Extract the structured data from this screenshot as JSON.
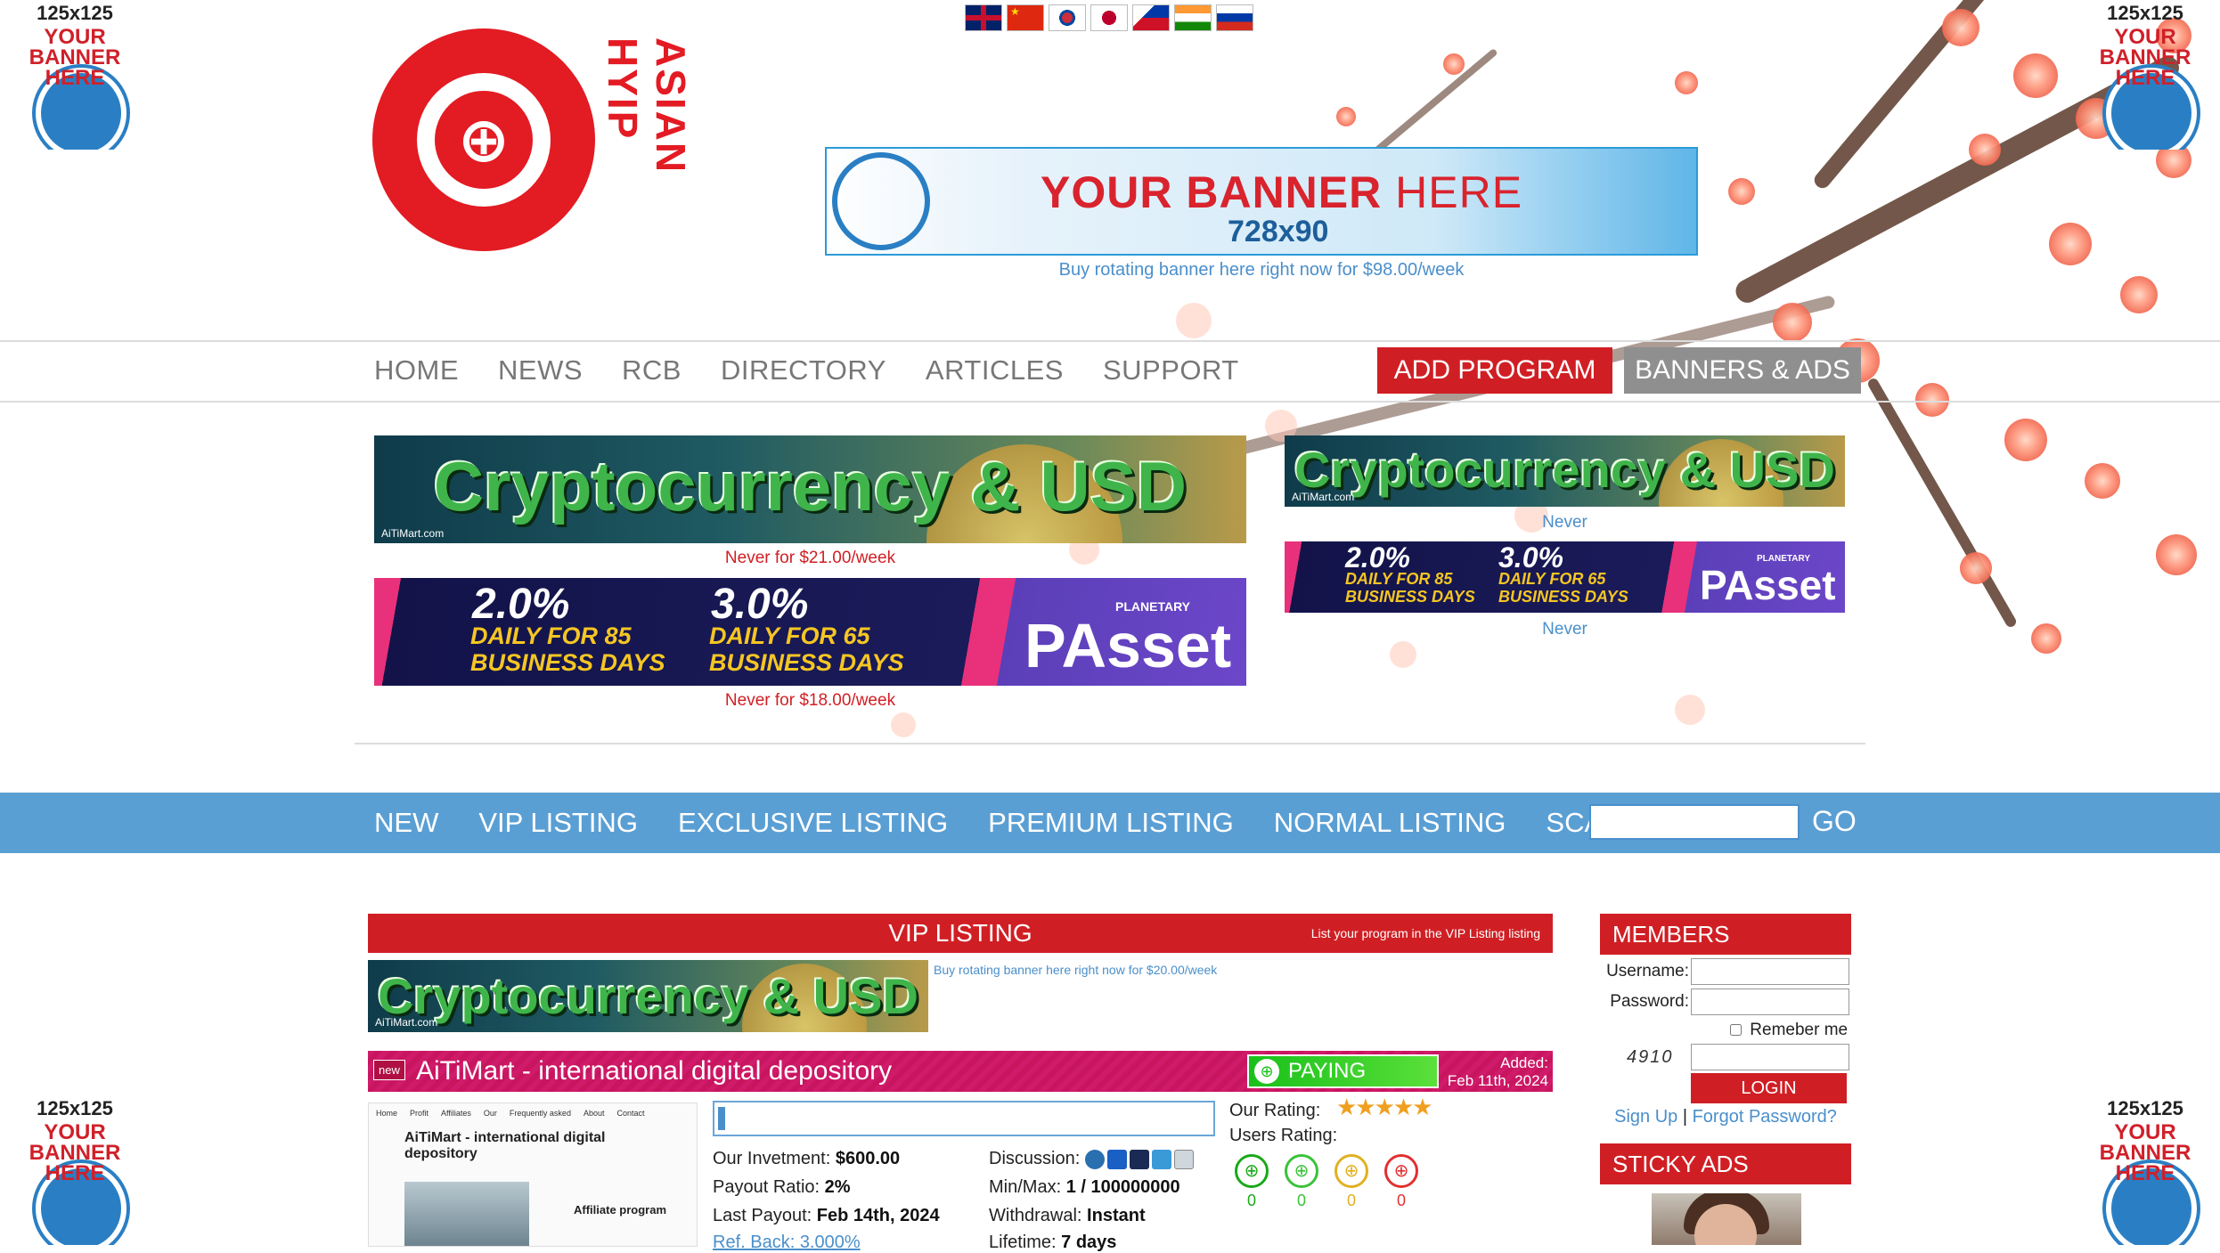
{
  "side_ads": {
    "size": "125x125",
    "line1": "YOUR",
    "line2": "BANNER",
    "line3": "HERE"
  },
  "logo": {
    "brand": "ASIAN HYIP"
  },
  "flags": [
    "English",
    "Chinese",
    "Korean",
    "Japanese",
    "Filipino",
    "Hindi",
    "Russian"
  ],
  "top_banner": {
    "title_bold": "YOUR BANNER",
    "title_light": "HERE",
    "size": "728x90",
    "caption": "Buy rotating banner here right now for $98.00/week"
  },
  "main_nav": {
    "items": [
      "HOME",
      "NEWS",
      "RCB",
      "DIRECTORY",
      "ARTICLES",
      "SUPPORT"
    ],
    "add_program": "ADD PROGRAM",
    "banners_ads": "BANNERS & ADS"
  },
  "banners": {
    "crypto_text": "Cryptocurrency & USD",
    "crypto_mark": "AiTiMart.com",
    "passet_rate1": "2.0%",
    "passet_rate2": "3.0%",
    "passet_daily1": "DAILY FOR 85",
    "passet_daily2": "DAILY FOR 65",
    "passet_business": "BUSINESS DAYS",
    "passet_logo": "PAsset",
    "passet_planetary": "PLANETARY",
    "left_cap1": "Never for $21.00/week",
    "left_cap2": "Never for $18.00/week",
    "right_cap1": "Never",
    "right_cap2": "Never"
  },
  "listing_nav": {
    "items": [
      "NEW",
      "VIP LISTING",
      "EXCLUSIVE LISTING",
      "PREMIUM LISTING",
      "NORMAL LISTING",
      "SCAM"
    ],
    "search_value": "",
    "go": "GO"
  },
  "vip": {
    "title": "VIP LISTING",
    "sub_link": "List your program in the VIP Listing listing",
    "banner_caption": "Buy rotating banner here right now for $20.00/week"
  },
  "program": {
    "badge": "new",
    "name": "AiTiMart - international digital depository",
    "status": "PAYING",
    "added_label": "Added:",
    "added_date": "Feb 11th, 2024",
    "thumb_nav": [
      "Home",
      "Profit",
      "Affiliates",
      "Our",
      "Frequently asked",
      "About",
      "Contact"
    ],
    "thumb_title": "AiTiMart - international digital depository",
    "thumb_aff": "Affiliate program",
    "progress": 0.01,
    "investment_label": "Our Invetment:",
    "investment": "$600.00",
    "payout_label": "Payout Ratio:",
    "payout": "2%",
    "last_payout_label": "Last Payout:",
    "last_payout": "Feb 14th, 2024",
    "ref_back": "Ref. Back: 3.000%",
    "discussion_label": "Discussion:",
    "minmax_label": "Min/Max:",
    "minmax": "1 / 100000000",
    "withdrawal_label": "Withdrawal:",
    "withdrawal": "Instant",
    "lifetime_label": "Lifetime:",
    "lifetime": "7 days",
    "our_rating_label": "Our Rating:",
    "our_rating": 5,
    "users_rating_label": "Users Rating:",
    "users_rating_counts": [
      "0",
      "0",
      "0",
      "0"
    ]
  },
  "members": {
    "title": "MEMBERS",
    "username_label": "Username:",
    "password_label": "Password:",
    "remember": "Remeber me",
    "captcha": "4910",
    "login": "LOGIN",
    "signup": "Sign Up",
    "forgot": "Forgot Password?"
  },
  "sticky_ads": {
    "title": "STICKY ADS"
  },
  "colors": {
    "brand_red": "#d01f24",
    "nav_blue": "#5a9fd4",
    "link_blue": "#4a8fcb"
  }
}
